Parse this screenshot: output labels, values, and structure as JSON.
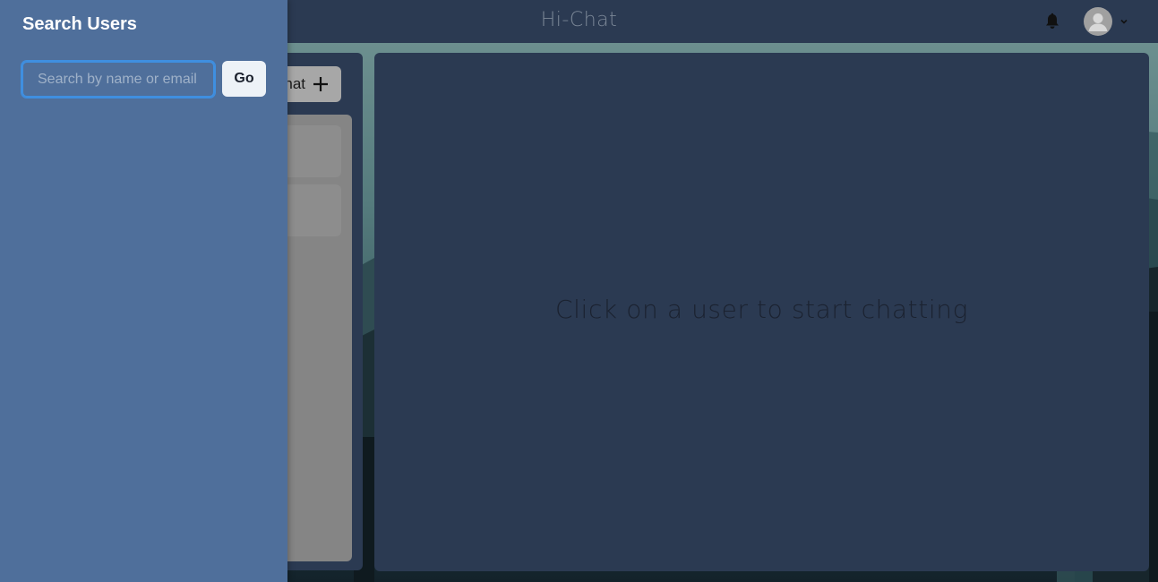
{
  "header": {
    "app_title": "Hi-Chat"
  },
  "chats_panel": {
    "new_chat_label_visible": "hat"
  },
  "chat_area": {
    "empty_message": "Click on a user to start chatting"
  },
  "search_drawer": {
    "title": "Search Users",
    "search_placeholder": "Search by name or email",
    "search_value": "",
    "go_label": "Go"
  },
  "icons": {
    "notification": "bell-icon",
    "avatar": "user-avatar-icon",
    "menu": "chevron-down-icon",
    "new_chat": "plus-icon"
  },
  "colors": {
    "header_bg": "#2b3a52",
    "drawer_bg": "#4f6f9b",
    "input_focus": "#3f8fe0",
    "button_bg": "#edf2f7"
  }
}
